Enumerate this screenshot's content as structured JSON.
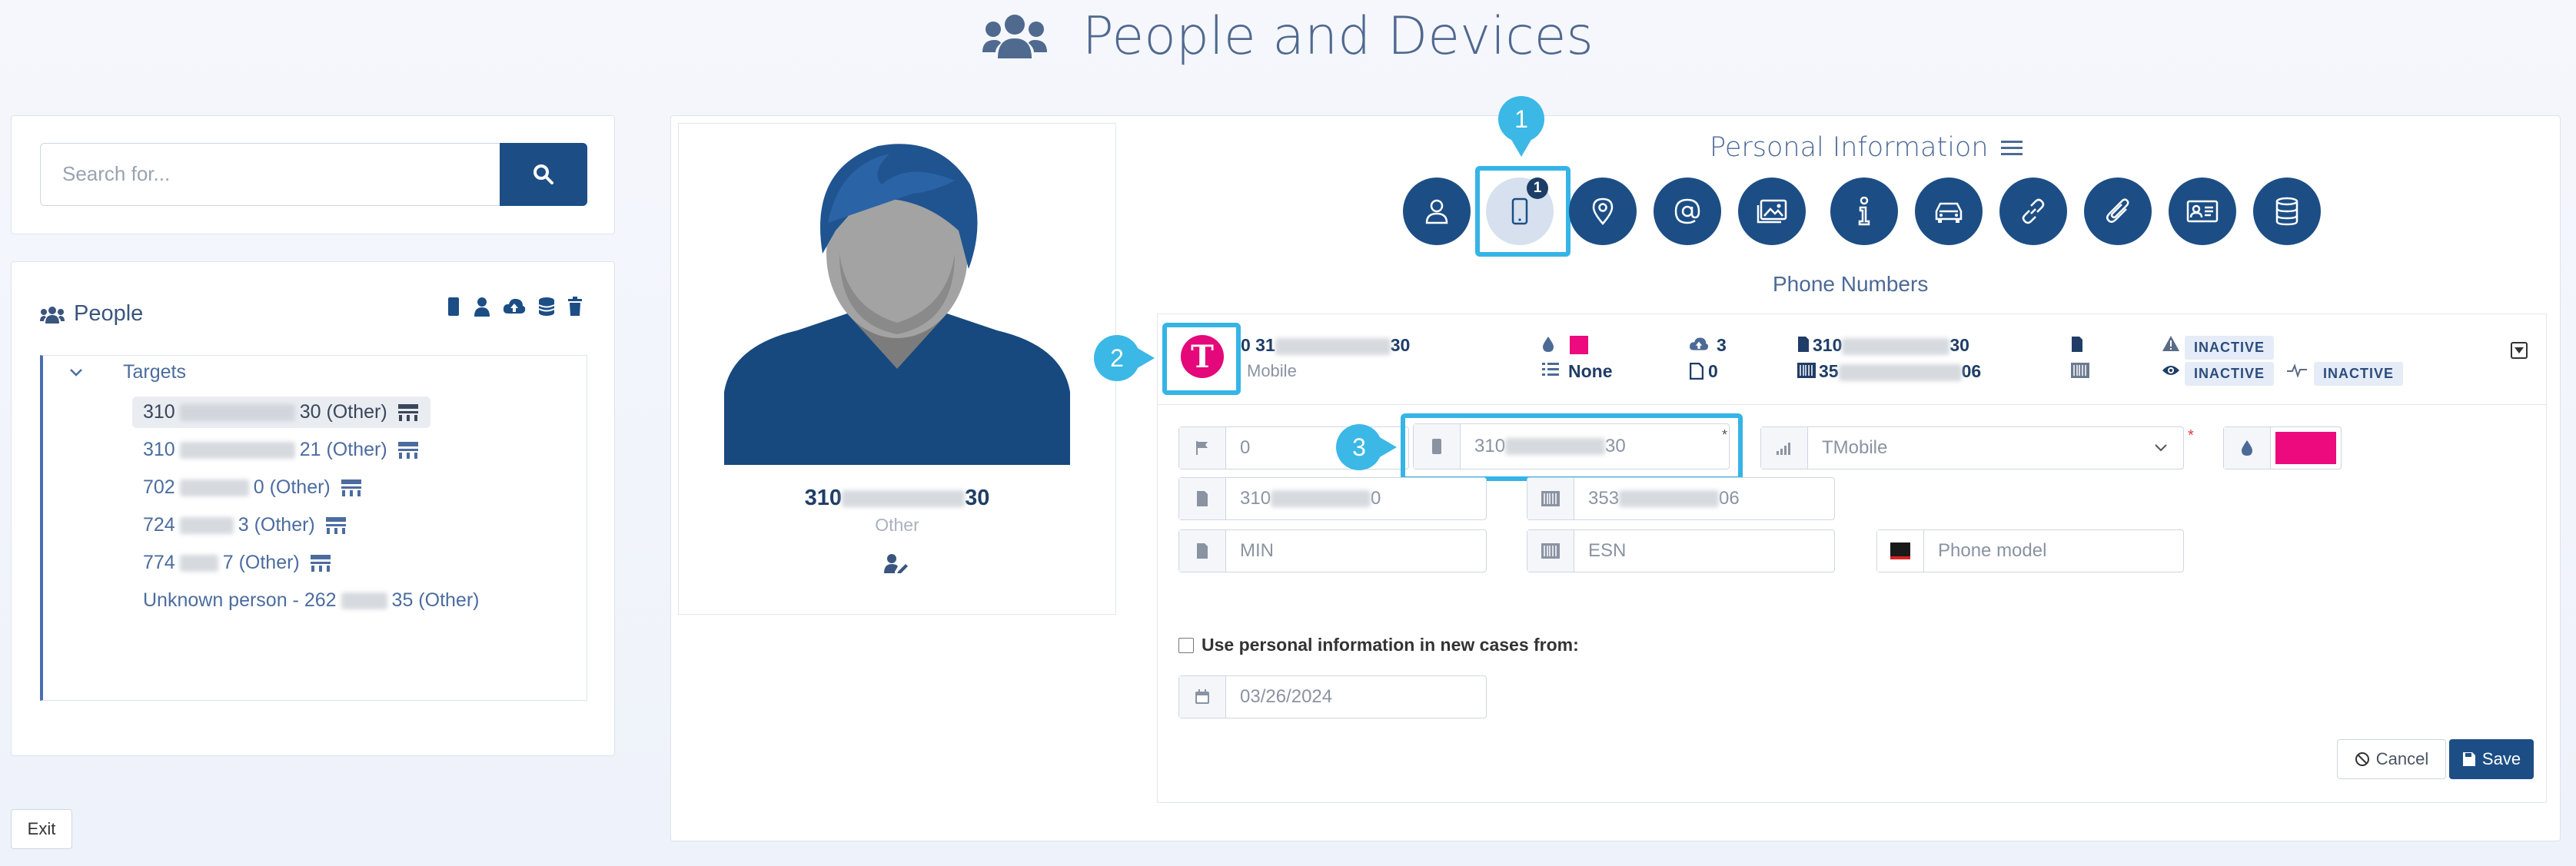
{
  "header": {
    "title": "People and Devices"
  },
  "search": {
    "placeholder": "Search for..."
  },
  "people": {
    "title": "People",
    "tree_root": "Targets",
    "items": [
      {
        "prefix": "310",
        "suffix": "30 (Other)"
      },
      {
        "prefix": "310",
        "suffix": "21 (Other)"
      },
      {
        "prefix": "702",
        "suffix": "0 (Other)"
      },
      {
        "prefix": "724",
        "suffix": "3 (Other)"
      },
      {
        "prefix": "774",
        "suffix": "7 (Other)"
      },
      {
        "prefix": "Unknown person - 262",
        "suffix": "35 (Other)"
      }
    ]
  },
  "profile": {
    "number_prefix": "310",
    "number_suffix": "30",
    "category": "Other"
  },
  "personal_info": {
    "title": "Personal Information",
    "subsection": "Phone Numbers",
    "phone_badge_count": "1"
  },
  "callouts": [
    "1",
    "2",
    "3"
  ],
  "phone_row": {
    "number_prefix": "0 31",
    "number_suffix": "30",
    "carrier": "Mobile",
    "color": "#ec0a7e",
    "assignment": "None",
    "upload_count": "3",
    "file_count": "0",
    "imsi_prefix": "310",
    "imsi_suffix": "30",
    "imei_prefix": "35",
    "imei_suffix": "06",
    "status1": "INACTIVE",
    "status2": "INACTIVE",
    "status3": "INACTIVE"
  },
  "form": {
    "priority": "0",
    "phone_prefix": "310",
    "phone_suffix": "30",
    "carrier": "TMobile",
    "color": "#ec0a7e",
    "imsi_prefix": "310",
    "imsi_suffix": "0",
    "imei_prefix": "353",
    "imei_suffix": "06",
    "min_placeholder": "MIN",
    "esn_placeholder": "ESN",
    "model_placeholder": "Phone model",
    "checkbox_label": "Use personal information in new cases from:",
    "date": "03/26/2024",
    "cancel_label": "Cancel",
    "save_label": "Save"
  },
  "footer": {
    "exit_label": "Exit"
  },
  "colors": {
    "brand": "#1c4e85",
    "accent": "#3bb8e6",
    "magenta": "#ec0a7e"
  }
}
